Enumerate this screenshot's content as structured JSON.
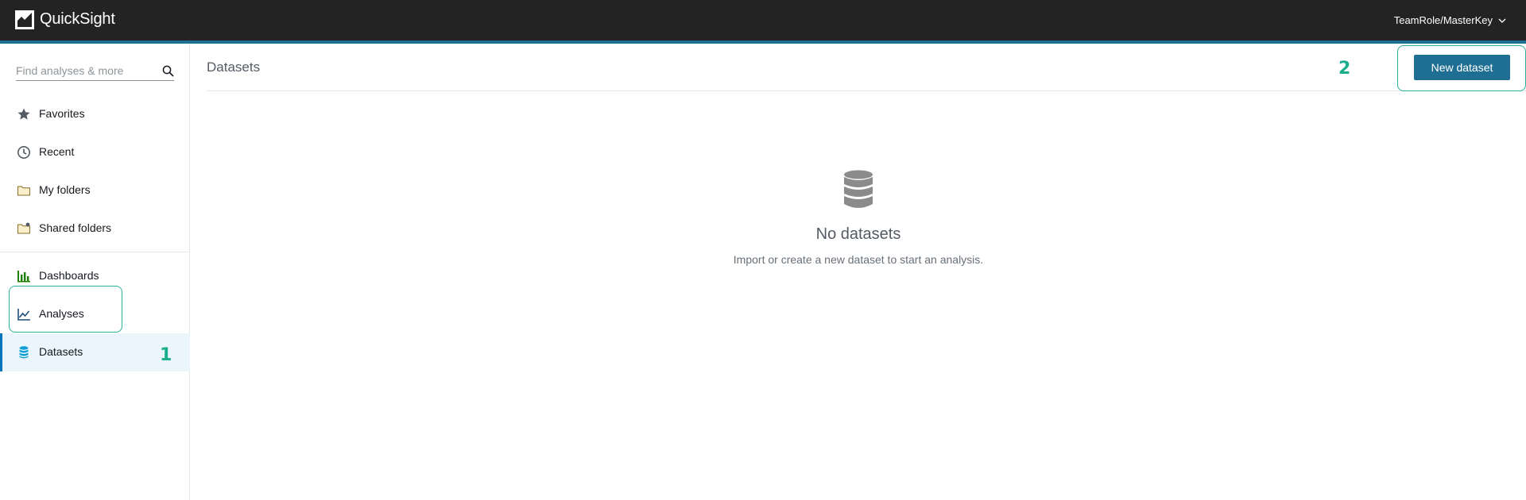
{
  "app": {
    "brand": "QuickSight",
    "user": "TeamRole/MasterKey"
  },
  "colors": {
    "topbar": "#232323",
    "accent": "#1f6f94",
    "annotation": "#2bb39a",
    "active_bg": "#eaf6fb"
  },
  "sidebar": {
    "search_placeholder": "Find analyses & more",
    "items": [
      {
        "label": "Favorites",
        "icon": "star-icon"
      },
      {
        "label": "Recent",
        "icon": "clock-icon"
      },
      {
        "label": "My folders",
        "icon": "folder-icon"
      },
      {
        "label": "Shared folders",
        "icon": "shared-folder-icon"
      },
      {
        "label": "Dashboards",
        "icon": "dashboard-icon"
      },
      {
        "label": "Analyses",
        "icon": "line-chart-icon"
      },
      {
        "label": "Datasets",
        "icon": "database-icon",
        "active": true
      }
    ]
  },
  "main": {
    "title": "Datasets",
    "new_button_label": "New dataset",
    "empty_title": "No datasets",
    "empty_description": "Import or create a new dataset to start an analysis."
  },
  "annotations": {
    "step1": "1",
    "step2": "2"
  }
}
